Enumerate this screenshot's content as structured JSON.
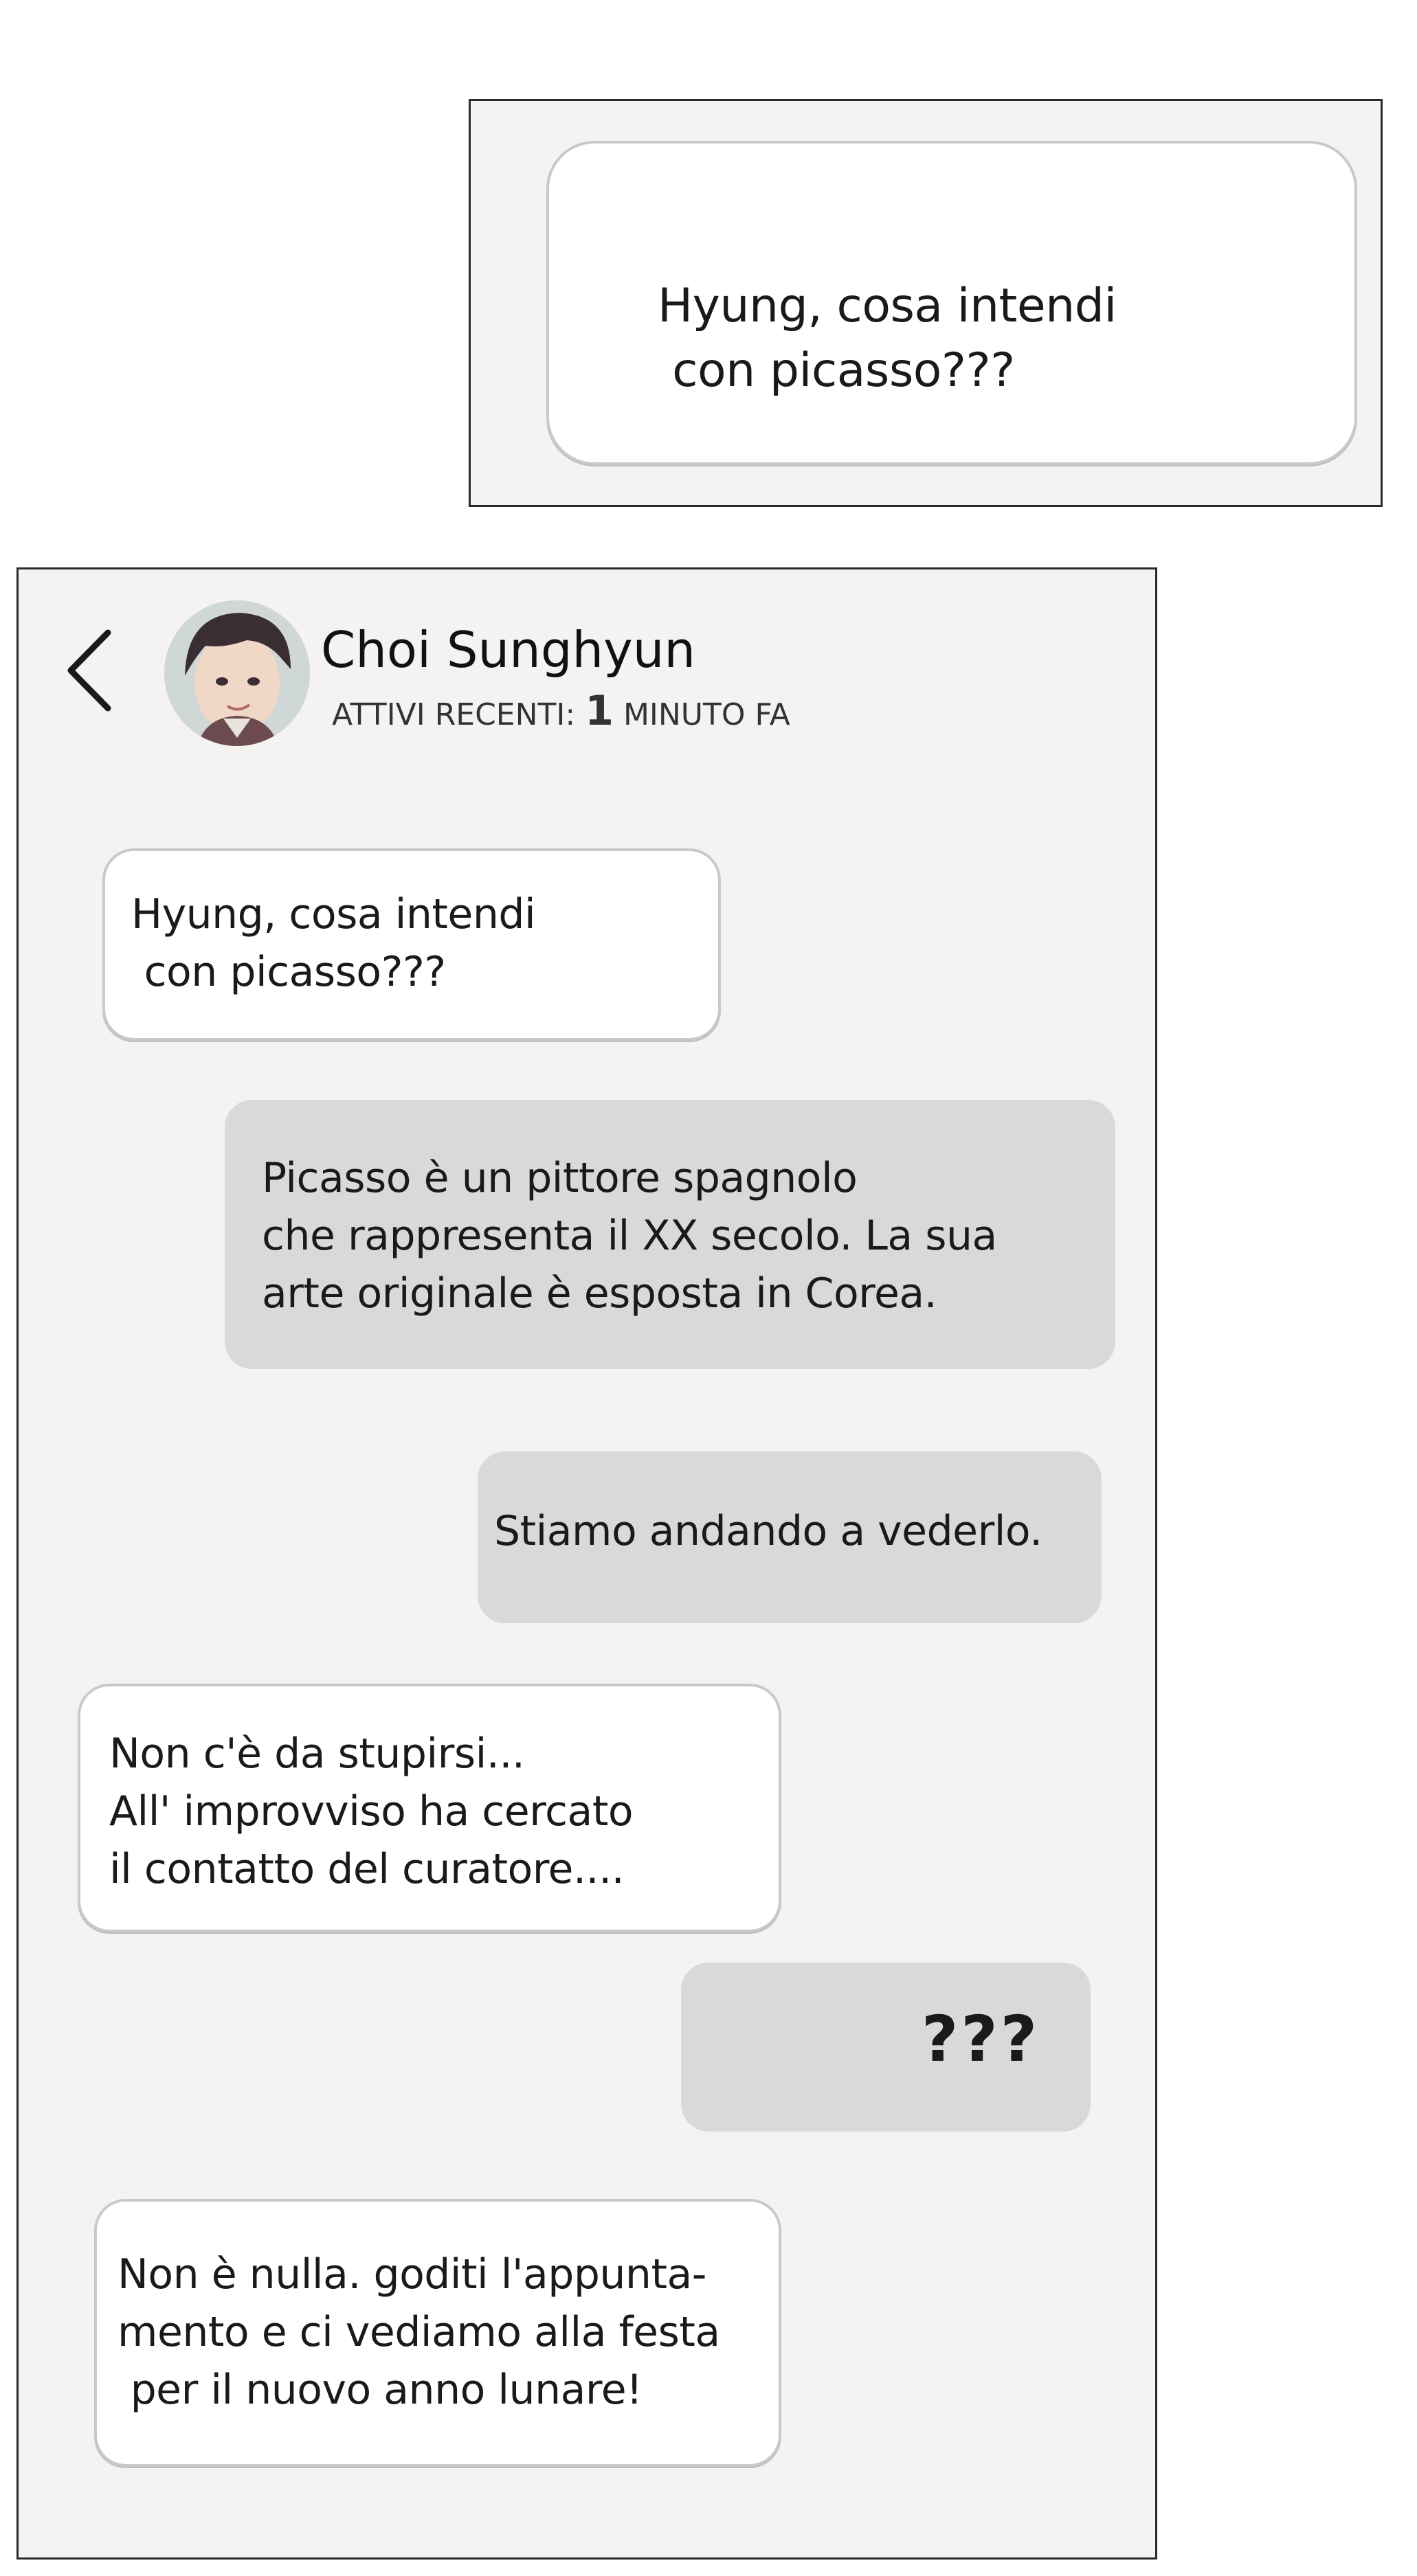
{
  "top_panel": {
    "bubble_text": "Hyung, cosa intendi\n con picasso???"
  },
  "chat": {
    "header": {
      "back_icon": "chevron-left-icon",
      "contact_name": "Choi Sunghyun",
      "status_prefix": "ATTIVI RECENTI:",
      "status_number": "1",
      "status_suffix": "MINUTO FA"
    },
    "messages": [
      {
        "direction": "incoming",
        "text": "Hyung, cosa intendi\n con picasso???"
      },
      {
        "direction": "outgoing",
        "text": "Picasso è un pittore spagnolo\nche rappresenta il XX secolo. La sua\narte originale è esposta in Corea."
      },
      {
        "direction": "outgoing",
        "text": "Stiamo andando a vederlo."
      },
      {
        "direction": "incoming",
        "text": "Non c'è da stupirsi...\nAll' improvviso ha cercato\nil contatto del curatore...."
      },
      {
        "direction": "outgoing",
        "text": "???"
      },
      {
        "direction": "incoming",
        "text": "Non è nulla. goditi l'appunta-\nmento e ci vediamo alla festa\n per il nuovo anno lunare!"
      }
    ]
  },
  "colors": {
    "panel_background": "#f4f3f1",
    "incoming_bubble": "#ffffff",
    "outgoing_bubble": "#d9d9d9",
    "panel_border": "#2b2b2b"
  }
}
